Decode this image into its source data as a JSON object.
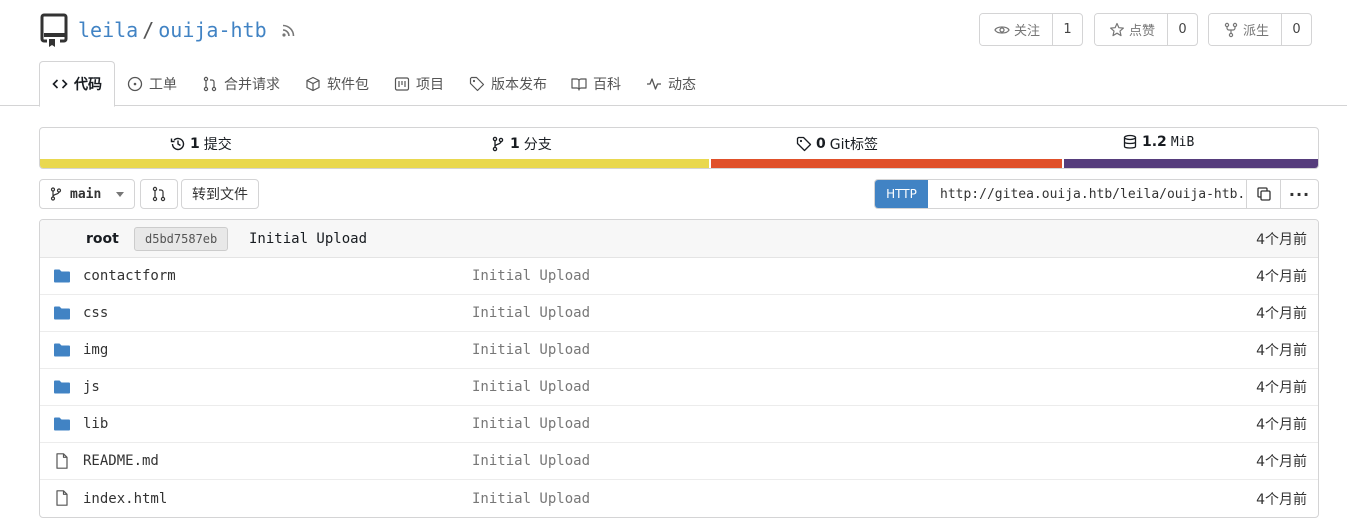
{
  "repo": {
    "owner": "leila",
    "separator": "/",
    "name": "ouija-htb"
  },
  "actions": {
    "watch": {
      "label": "关注",
      "count": "1"
    },
    "star": {
      "label": "点赞",
      "count": "0"
    },
    "fork": {
      "label": "派生",
      "count": "0"
    }
  },
  "tabs": [
    {
      "label": "代码",
      "icon": "code-icon"
    },
    {
      "label": "工单",
      "icon": "issue-icon"
    },
    {
      "label": "合并请求",
      "icon": "pull-request-icon"
    },
    {
      "label": "软件包",
      "icon": "package-icon"
    },
    {
      "label": "项目",
      "icon": "project-icon"
    },
    {
      "label": "版本发布",
      "icon": "tag-icon"
    },
    {
      "label": "百科",
      "icon": "book-icon"
    },
    {
      "label": "动态",
      "icon": "pulse-icon"
    }
  ],
  "stats": {
    "commits": {
      "count": "1",
      "label": "提交"
    },
    "branches": {
      "count": "1",
      "label": "分支"
    },
    "tags": {
      "count": "0",
      "label": "Git标签"
    },
    "size": {
      "count": "1.2",
      "label": "MiB"
    }
  },
  "language_colors": [
    "#e9d84f",
    "#e0502a",
    "#563d7c"
  ],
  "language_shares": [
    0.525,
    0.276,
    0.199
  ],
  "toolbar": {
    "branch": "main",
    "goto_file": "转到文件",
    "clone_protocol": "HTTP",
    "clone_url": "http://gitea.ouija.htb/leila/ouija-htb.git",
    "more": "···"
  },
  "latest_commit": {
    "author": "root",
    "sha": "d5bd7587eb",
    "message": "Initial Upload",
    "age": "4个月前"
  },
  "files": [
    {
      "name": "contactform",
      "type": "folder",
      "message": "Initial Upload",
      "age": "4个月前"
    },
    {
      "name": "css",
      "type": "folder",
      "message": "Initial Upload",
      "age": "4个月前"
    },
    {
      "name": "img",
      "type": "folder",
      "message": "Initial Upload",
      "age": "4个月前"
    },
    {
      "name": "js",
      "type": "folder",
      "message": "Initial Upload",
      "age": "4个月前"
    },
    {
      "name": "lib",
      "type": "folder",
      "message": "Initial Upload",
      "age": "4个月前"
    },
    {
      "name": "README.md",
      "type": "file",
      "message": "Initial Upload",
      "age": "4个月前"
    },
    {
      "name": "index.html",
      "type": "file",
      "message": "Initial Upload",
      "age": "4个月前"
    }
  ]
}
